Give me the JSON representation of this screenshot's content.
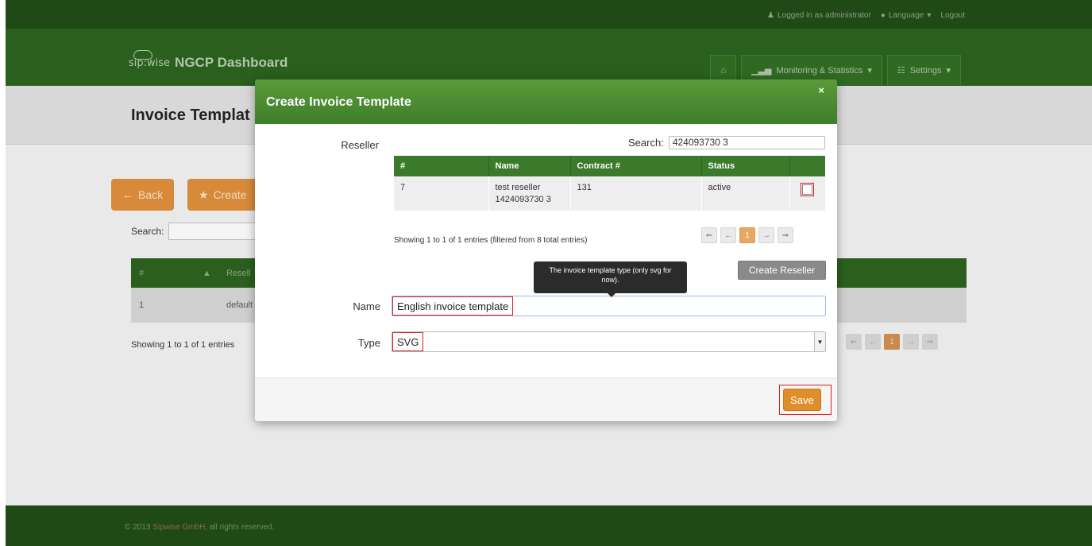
{
  "topbar": {
    "logged_in": "Logged in as administrator",
    "language": "Language",
    "logout": "Logout"
  },
  "header": {
    "brand_logo": "sip:wise",
    "brand_name": "NGCP Dashboard",
    "nav": [
      {
        "label": "",
        "icon": "home-icon"
      },
      {
        "label": "Monitoring & Statistics",
        "icon": "bar-chart-icon"
      },
      {
        "label": "Settings",
        "icon": "grid-icon"
      }
    ]
  },
  "background": {
    "page_title": "Invoice Templat",
    "back_button": "Back",
    "create_button": "Create",
    "search_label": "Search:",
    "table_headers": [
      "#",
      "Resell"
    ],
    "row": [
      "1",
      "default"
    ],
    "info": "Showing 1 to 1 of 1 entries",
    "pager": [
      "⇐",
      "←",
      "1",
      "→",
      "⇒"
    ]
  },
  "modal": {
    "title": "Create Invoice Template",
    "close": "×",
    "reseller_label": "Reseller",
    "search_label": "Search:",
    "search_value": "424093730 3",
    "reseller_table": {
      "headers": [
        "#",
        "Name",
        "Contract #",
        "Status",
        ""
      ],
      "rows": [
        {
          "id": "7",
          "name_line1": "test reseller",
          "name_line2": "1424093730 3",
          "contract": "131",
          "status": "active"
        }
      ]
    },
    "table_info": "Showing 1 to 1 of 1 entries (filtered from 8 total entries)",
    "pager": [
      "⇐",
      "←",
      "1",
      "→",
      "⇒"
    ],
    "create_reseller": "Create Reseller",
    "name_label": "Name",
    "name_value": "English invoice template",
    "tooltip": "The invoice template type (only svg for now).",
    "type_label": "Type",
    "type_value": "SVG",
    "save": "Save"
  },
  "footer": {
    "prefix": "© 2013 ",
    "company": "Sipwise GmbH",
    "suffix": ", all rights reserved."
  },
  "colors": {
    "topbar": "#1f4a15",
    "header": "#2a5f1d",
    "modal_header": "#4a8c32",
    "accent_orange": "#e08e2b",
    "highlight_red": "#e02020"
  }
}
